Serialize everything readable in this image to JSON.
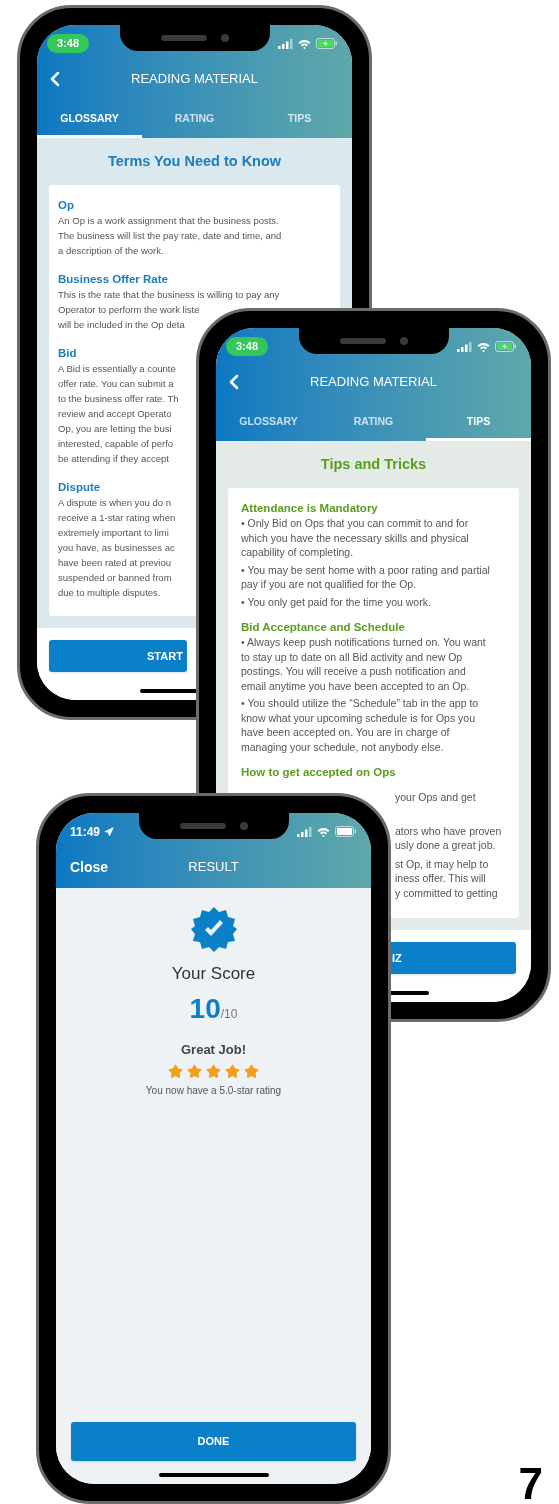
{
  "phones": [
    {
      "kind": "glossary",
      "status": {
        "time": "3:48",
        "time_pill": true,
        "location": false,
        "charging": true
      },
      "title": "READING MATERIAL",
      "tabs": [
        {
          "label": "GLOSSARY",
          "selected": true
        },
        {
          "label": "RATING",
          "selected": false
        },
        {
          "label": "TIPS",
          "selected": false
        }
      ],
      "heading": "Terms You Need to Know",
      "sections": [
        {
          "title": "Op",
          "paragraphs": [
            [
              "An Op is a work assignment that the business posts.",
              "The business will list the pay rate, date and time, and",
              "a description of the work."
            ]
          ]
        },
        {
          "title": "Business Offer Rate",
          "paragraphs": [
            [
              "This is the rate that the business is willing to pay any",
              "Operator to perform the work liste",
              "will be included in the Op deta"
            ]
          ]
        },
        {
          "title": "Bid",
          "paragraphs": [
            [
              "A Bid is essentially a counte",
              "offer rate. You can submit a",
              "to the business offer rate. Th",
              "review and accept Operato",
              "Op, you are letting the busi",
              "interested, capable of perfo",
              "be attending if they accept"
            ]
          ]
        },
        {
          "title": "Dispute",
          "paragraphs": [
            [
              "A dispute is when you do n",
              "receive a 1-star rating when",
              "extremely important to limi",
              "you have, as businesses ac",
              "have been rated at previou",
              "suspended or banned from",
              "due to multiple disputes."
            ]
          ]
        }
      ],
      "button": "START"
    },
    {
      "kind": "tips",
      "status": {
        "time": "3:48",
        "time_pill": true,
        "location": false,
        "charging": true
      },
      "title": "READING MATERIAL",
      "tabs": [
        {
          "label": "GLOSSARY",
          "selected": false
        },
        {
          "label": "RATING",
          "selected": false
        },
        {
          "label": "TIPS",
          "selected": true
        }
      ],
      "heading": "Tips and Tricks",
      "sections": [
        {
          "title": "Attendance is Mandatory",
          "paragraphs": [
            [
              "• Only Bid on Ops that you can commit to and for",
              "which you have the necessary skills and physical",
              "capability of completing."
            ],
            [
              "• You may be sent home with a poor rating and partial",
              "pay if you are not qualified for the Op."
            ],
            [
              "• You only get paid for the time you work."
            ]
          ]
        },
        {
          "title": "Bid Acceptance and Schedule",
          "paragraphs": [
            [
              "• Always keep push notifications turned on. You want",
              "to stay up to date on all Bid activity and new Op",
              "postings. You will receive a push notification and",
              "email anytime you have been accepted to an Op."
            ],
            [
              "• You should utilize the “Schedule” tab in the app to",
              "know what your upcoming schedule is for Ops you",
              "have been accepted on. You are in charge of",
              "managing your schedule, not anybody else."
            ]
          ]
        },
        {
          "title": "How to get accepted on Ops",
          "fragments": [
            [
              "your Ops and get"
            ],
            [
              "ators who have proven",
              "usly done a great job."
            ],
            [
              "st Op, it may help to",
              "iness offer. This will",
              "y committed to getting"
            ]
          ]
        }
      ],
      "button": "IZ"
    },
    {
      "kind": "result",
      "status": {
        "time": "11:49",
        "time_pill": false,
        "location": true,
        "charging": false
      },
      "close": "Close",
      "title": "RESULT",
      "score_title": "Your Score",
      "score": "10",
      "score_total": "/10",
      "praise": "Great Job!",
      "stars": 5,
      "rating_note": "You now have a 5.0-star rating",
      "button": "DONE"
    }
  ],
  "page_number": "7"
}
